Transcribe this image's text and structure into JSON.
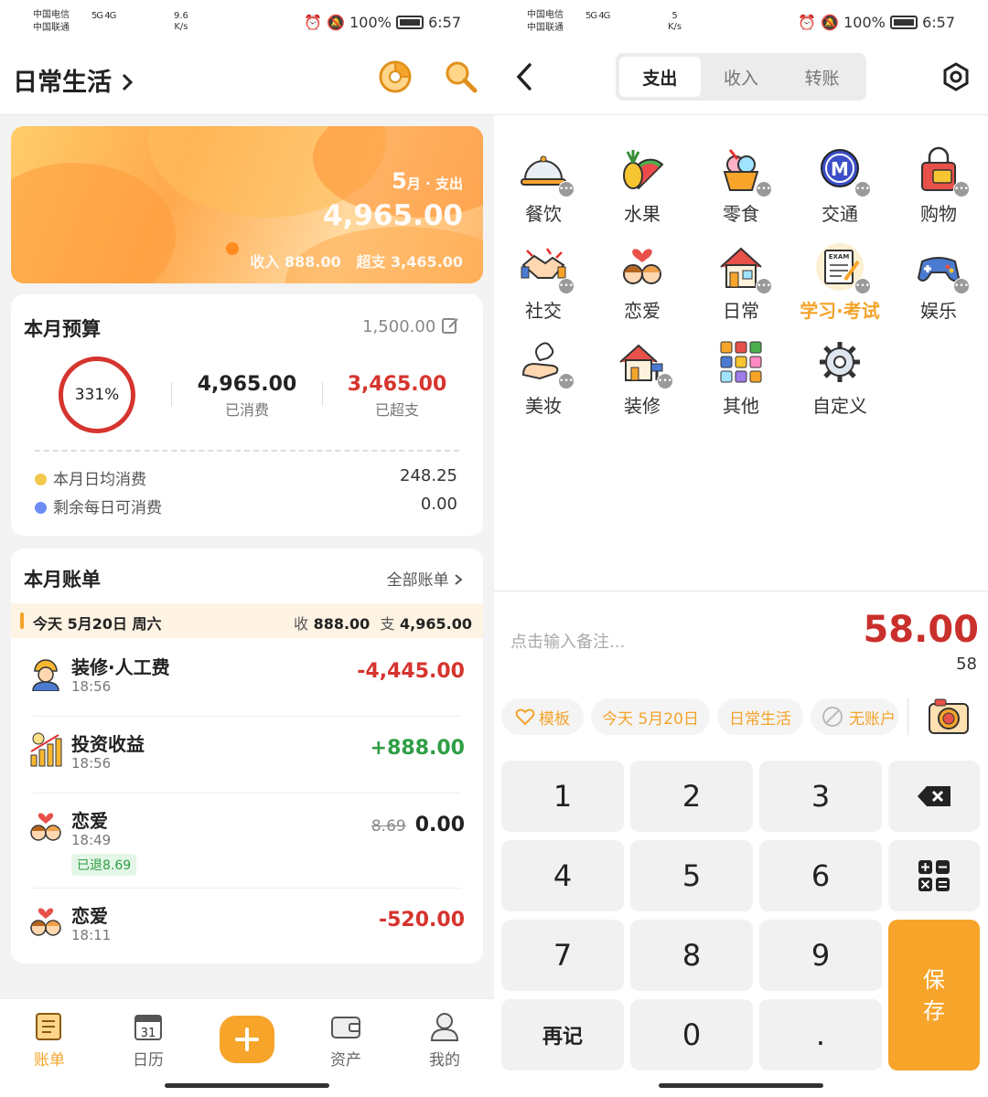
{
  "status_bar": {
    "carrier1": "中国电信",
    "carrier2": "中国联通",
    "network": "5G 4G",
    "speed_left": "9.6",
    "speed_right": "5",
    "speed_unit": "K/s",
    "battery": "100%",
    "time": "6:57"
  },
  "left": {
    "header": {
      "title": "日常生活",
      "chevron": "chevron-right-icon",
      "icons": [
        "pie-chart-icon",
        "search-icon"
      ]
    },
    "banner": {
      "month_number": "5",
      "month_suffix": "月 · 支出",
      "amount": "4,965.00",
      "income": "收入 888.00",
      "overspend": "超支 3,465.00"
    },
    "budget": {
      "title": "本月预算",
      "amount": "1,500.00",
      "percent": "331%",
      "spent_value": "4,965.00",
      "spent_label": "已消费",
      "over_value": "3,465.00",
      "over_label": "已超支",
      "rows": [
        {
          "label": "本月日均消费",
          "value": "248.25",
          "color": "#f2c94c"
        },
        {
          "label": "剩余每日可消费",
          "value": "0.00",
          "color": "#6c8cf5"
        }
      ]
    },
    "bills": {
      "title": "本月账单",
      "all_link": "全部账单",
      "day_header": {
        "date": "今天 5月20日 周六",
        "income_label": "收",
        "income": "888.00",
        "expense_label": "支",
        "expense": "4,965.00"
      },
      "items": [
        {
          "name": "装修·人工费",
          "time": "18:56",
          "amount": "-4,445.00",
          "icon": "worker-icon"
        },
        {
          "name": "投资收益",
          "time": "18:56",
          "amount": "+888.00",
          "icon": "investment-chart-icon"
        },
        {
          "name": "恋爱",
          "time": "18:49",
          "original": "8.69",
          "amount": "0.00",
          "refund": "已退8.69",
          "icon": "couple-icon"
        },
        {
          "name": "恋爱",
          "time": "18:11",
          "amount": "-520.00",
          "icon": "couple-icon"
        }
      ]
    },
    "nav": [
      {
        "label": "账单",
        "icon": "ledger-icon",
        "active": true
      },
      {
        "label": "日历",
        "icon": "calendar-icon",
        "day": "31"
      },
      {
        "label": "",
        "icon": "plus-icon"
      },
      {
        "label": "资产",
        "icon": "wallet-icon"
      },
      {
        "label": "我的",
        "icon": "profile-icon"
      }
    ]
  },
  "right": {
    "header": {
      "back": "back-arrow-icon",
      "tabs": [
        "支出",
        "收入",
        "转账"
      ],
      "active_tab": "支出",
      "settings": "settings-hex-icon"
    },
    "categories": [
      {
        "label": "餐饮",
        "icon": "food-cloche-icon"
      },
      {
        "label": "水果",
        "icon": "fruit-icon"
      },
      {
        "label": "零食",
        "icon": "snack-icon"
      },
      {
        "label": "交通",
        "icon": "metro-icon",
        "letter": "M"
      },
      {
        "label": "购物",
        "icon": "shopping-bag-icon"
      },
      {
        "label": "社交",
        "icon": "handshake-icon"
      },
      {
        "label": "恋爱",
        "icon": "couple-icon"
      },
      {
        "label": "日常",
        "icon": "house-icon"
      },
      {
        "label": "学习·考试",
        "icon": "exam-icon",
        "selected": true,
        "badge": "EXAM"
      },
      {
        "label": "娱乐",
        "icon": "gamepad-icon"
      },
      {
        "label": "美妆",
        "icon": "hand-cream-icon"
      },
      {
        "label": "装修",
        "icon": "renovation-icon"
      },
      {
        "label": "其他",
        "icon": "grid-icon"
      },
      {
        "label": "自定义",
        "icon": "gear-icon"
      }
    ],
    "note_placeholder": "点击输入备注...",
    "amount": "58.00",
    "amount_expression": "58",
    "chips": [
      {
        "label": "模板",
        "icon": "heart-outline-icon"
      },
      {
        "label": "今天 5月20日"
      },
      {
        "label": "日常生活"
      },
      {
        "label": "无账户",
        "icon": "no-account-icon"
      }
    ],
    "camera": "camera-icon",
    "keys": [
      "1",
      "2",
      "3",
      "4",
      "5",
      "6",
      "7",
      "8",
      "9",
      "再记",
      "0",
      "."
    ],
    "backspace": "backspace-icon",
    "calculator": "calculator-icon",
    "save_line1": "保",
    "save_line2": "存"
  },
  "colors": {
    "accent": "#f7a42b",
    "expense": "#d6342e",
    "income": "#2f9e44"
  }
}
